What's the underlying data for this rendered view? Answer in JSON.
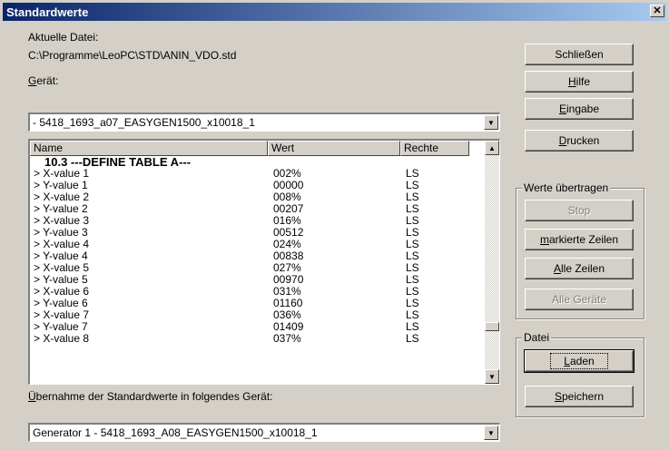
{
  "window": {
    "title": "Standardwerte",
    "close_glyph": "✕"
  },
  "current_file": {
    "label": "Aktuelle Datei:",
    "path": "C:\\Programme\\LeoPC\\STD\\ANIN_VDO.std"
  },
  "device": {
    "label_mnemonic": "G",
    "label_rest": "erät:",
    "selected": "- 5418_1693_a07_EASYGEN1500_x10018_1"
  },
  "table": {
    "columns": [
      "Name",
      "Wert",
      "Rechte"
    ],
    "heading": "10.3 ---DEFINE TABLE A---",
    "rows": [
      {
        "name": "> X-value 1",
        "value": "002%",
        "rights": "LS"
      },
      {
        "name": "> Y-value 1",
        "value": "00000",
        "rights": "LS"
      },
      {
        "name": "> X-value 2",
        "value": "008%",
        "rights": "LS"
      },
      {
        "name": "> Y-value 2",
        "value": "00207",
        "rights": "LS"
      },
      {
        "name": "> X-value 3",
        "value": "016%",
        "rights": "LS"
      },
      {
        "name": "> Y-value 3",
        "value": "00512",
        "rights": "LS"
      },
      {
        "name": "> X-value 4",
        "value": "024%",
        "rights": "LS"
      },
      {
        "name": "> Y-value 4",
        "value": "00838",
        "rights": "LS"
      },
      {
        "name": "> X-value 5",
        "value": "027%",
        "rights": "LS"
      },
      {
        "name": "> Y-value 5",
        "value": "00970",
        "rights": "LS"
      },
      {
        "name": "> X-value 6",
        "value": "031%",
        "rights": "LS"
      },
      {
        "name": "> Y-value 6",
        "value": "01160",
        "rights": "LS"
      },
      {
        "name": "> X-value 7",
        "value": "036%",
        "rights": "LS"
      },
      {
        "name": "> Y-value 7",
        "value": "01409",
        "rights": "LS"
      },
      {
        "name": "> X-value 8",
        "value": "037%",
        "rights": "LS"
      }
    ]
  },
  "target": {
    "label_mnemonic": "Ü",
    "label_rest": "bernahme der Standardwerte in folgendes Gerät:",
    "selected": "Generator 1 - 5418_1693_A08_EASYGEN1500_x10018_1"
  },
  "buttons": {
    "close": "Schließen",
    "help_mnemonic": "H",
    "help_rest": "ilfe",
    "input_mnemonic": "E",
    "input_rest": "ingabe",
    "print_mnemonic": "D",
    "print_rest": "rucken"
  },
  "transfer_group": {
    "legend": "Werte übertragen",
    "stop": "Stop",
    "marked_mnemonic": "m",
    "marked_rest": "arkierte Zeilen",
    "all_rows_mnemonic": "A",
    "all_rows_rest": "lle Zeilen",
    "all_devices": "Alle Geräte"
  },
  "file_group": {
    "legend": "Datei",
    "load_mnemonic": "L",
    "load_rest": "aden",
    "save_mnemonic": "S",
    "save_rest": "peichern"
  }
}
